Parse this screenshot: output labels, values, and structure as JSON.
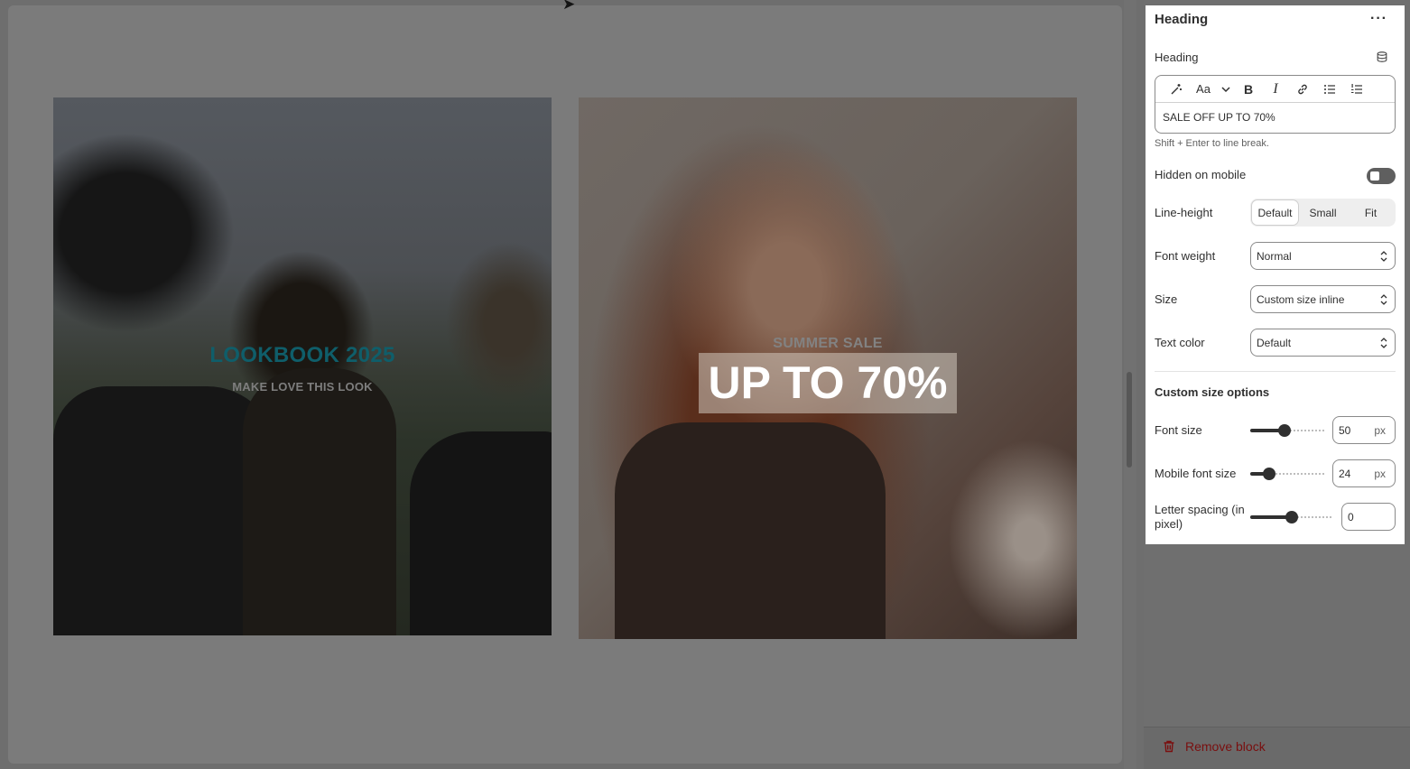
{
  "preview": {
    "lookbook": {
      "title": "LOOKBOOK 2025",
      "subtitle": "MAKE LOVE THIS LOOK"
    },
    "sale": {
      "subtitle": "SUMMER SALE",
      "title": "UP TO 70%"
    }
  },
  "panel": {
    "title": "Heading",
    "more_label": "···",
    "heading_field": {
      "label": "Heading",
      "value": "SALE OFF UP TO 70%",
      "hint": "Shift + Enter to line break.",
      "toolbar": [
        "magic-icon",
        "font-style-icon",
        "chevron-down-icon",
        "bold-icon",
        "italic-icon",
        "link-icon",
        "bullet-list-icon",
        "numbered-list-icon"
      ]
    },
    "hidden_on_mobile": {
      "label": "Hidden on mobile",
      "checked": false
    },
    "line_height": {
      "label": "Line-height",
      "options": [
        "Default",
        "Small",
        "Fit"
      ],
      "selected": "Default"
    },
    "font_weight": {
      "label": "Font weight",
      "value": "Normal"
    },
    "size": {
      "label": "Size",
      "value": "Custom size inline"
    },
    "text_color": {
      "label": "Text color",
      "value": "Default"
    },
    "custom_size": {
      "title": "Custom size options",
      "font_size": {
        "label": "Font size",
        "value": "50",
        "unit": "px",
        "level": 0.45
      },
      "mobile_font_size": {
        "label": "Mobile font size",
        "value": "24",
        "unit": "px",
        "level": 0.2
      },
      "letter_spacing": {
        "label": "Letter spacing (in pixel)",
        "value": "0",
        "level": 0.5
      }
    }
  },
  "footer": {
    "remove_label": "Remove block"
  },
  "colors": {
    "destructive": "#7a0f0f",
    "lookbook_title": "#0f5e6a"
  }
}
